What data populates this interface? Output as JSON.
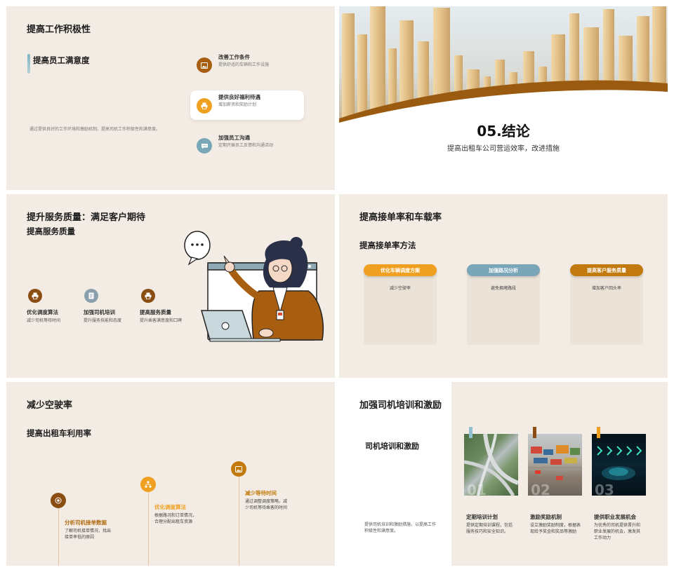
{
  "slide1": {
    "title": "提高工作积极性",
    "subtitle": "提高员工满意度",
    "description": "通过提供良好的工作环境和激励机制，提高司机工作积极性和满意度。",
    "items": [
      {
        "title": "改善工作条件",
        "desc": "提供舒适的车辆和工作设施"
      },
      {
        "title": "提供良好福利待遇",
        "desc": "增加薪资和奖励计划"
      },
      {
        "title": "加强员工沟通",
        "desc": "定期开展员工反馈和沟通活动"
      }
    ]
  },
  "slide2": {
    "title": "05.结论",
    "subtitle": "提高出租车公司营运效率，改进措施"
  },
  "slide3": {
    "title": "提升服务质量：满足客户期待",
    "subtitle": "提高服务质量",
    "items": [
      {
        "title": "优化调度算法",
        "desc": "减少司机等待时间"
      },
      {
        "title": "加强司机培训",
        "desc": "提升服务技能和态度"
      },
      {
        "title": "提高服务质量",
        "desc": "提升乘客满意度和口碑"
      }
    ]
  },
  "slide4": {
    "title": "提高接单率和车载率",
    "subtitle": "提高接单率方法",
    "methods": [
      {
        "label": "优化车辆调度方案",
        "desc": "减少空驶率",
        "color": "#f0a020"
      },
      {
        "label": "加强路况分析",
        "desc": "避免拥堵路段",
        "color": "#7aa7b8"
      },
      {
        "label": "提高客户服务质量",
        "desc": "增加客户回头率",
        "color": "#c27a0e"
      }
    ]
  },
  "slide5": {
    "title": "减少空驶率",
    "subtitle": "提高出租车利用率",
    "items": [
      {
        "title": "分析司机接单数据",
        "desc": "了解司机接单情况，找出接单率低的原因"
      },
      {
        "title": "优化调度算法",
        "desc": "根据路况和订单情况，合理分配出租车资源"
      },
      {
        "title": "减少等待时间",
        "desc": "通过调整调度策略，减少司机等待乘客的时间"
      }
    ]
  },
  "slide6": {
    "title": "加强司机培训和激励",
    "subtitle": "司机培训和激励",
    "description": "提供司机培训和激励措施，以提高工作积极性和满意度。",
    "cards": [
      {
        "num": "01",
        "title": "定期培训计划",
        "desc": "提供定期培训课程，包括服务技巧和安全知识。",
        "tag_color": "#8fc0cc"
      },
      {
        "num": "02",
        "title": "激励奖励机制",
        "desc": "设立激励奖励制度，根据表现给予奖金和奖品等激励",
        "tag_color": "#8a4d12"
      },
      {
        "num": "03",
        "title": "提供职业发展机会",
        "desc": "为优秀的司机提供晋升和职业发展的机会，激发其工作动力",
        "tag_color": "#f0a020"
      }
    ]
  },
  "colors": {
    "slide_bg": "#f3ece4",
    "accent_orange": "#f0a020",
    "accent_brown": "#9a5a10",
    "accent_blue": "#7aa7b8"
  }
}
